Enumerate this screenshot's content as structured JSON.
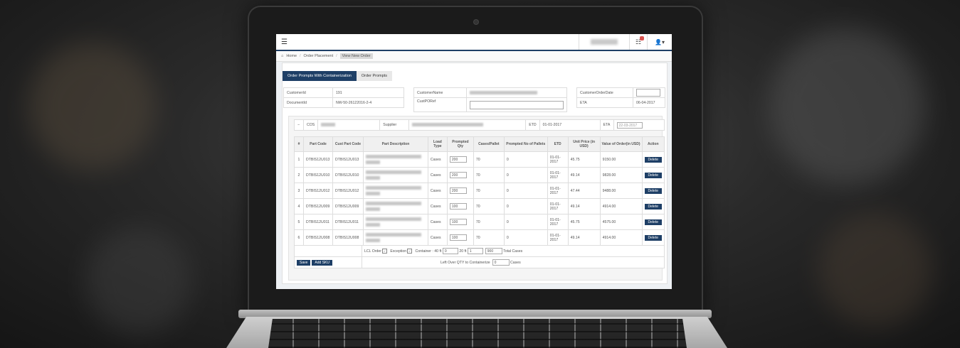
{
  "topbar": {
    "menu_icon": "hamburger-icon",
    "notification_icon": "list-icon",
    "user_icon": "user-icon",
    "user_caret": "▾"
  },
  "breadcrumb": {
    "home": "Home",
    "order_placement": "Order Placement",
    "current": "View New Order"
  },
  "tabs": {
    "containerization": "Order Prompts With Containerization",
    "order_prompts": "Order Prompts"
  },
  "info": {
    "customer_id_label": "CustomerId",
    "customer_id_value": "191",
    "document_id_label": "DocumentId",
    "document_id_value": "NW-50-26122016-2-4",
    "customer_name_label": "CustomerName",
    "cust_po_ref_label": "CustPORef",
    "customer_order_date_label": "CustomerOrderDate",
    "eta_label": "ETA",
    "eta_value": "06-04-2017"
  },
  "cos_row": {
    "toggle": "−",
    "cos_label": "COS",
    "supplier_label": "Supplier",
    "etd_label": "ETD",
    "etd_value": "01-01-2017",
    "eta_label": "ETA",
    "eta_value": "22-03-2017"
  },
  "grid": {
    "headers": [
      "#",
      "Part Code",
      "Cust Part Code",
      "Part Description",
      "Load Type",
      "Prompted Qty",
      "Cases/Pallet",
      "Prompted No of Pallets",
      "ETD",
      "Unit Price (in USD)",
      "Value of Order(in USD)",
      "Action"
    ],
    "rows": [
      {
        "n": "1",
        "part": "DTBIS12U013",
        "cust": "DTBIS12U013",
        "load": "Cases",
        "qty": "200",
        "cpp": "70",
        "pallets": "0",
        "etd": "01-01-2017",
        "price": "45.75",
        "value": "9150.00",
        "action": "Delete"
      },
      {
        "n": "2",
        "part": "DTBIS12U010",
        "cust": "DTBIS12U010",
        "load": "Cases",
        "qty": "200",
        "cpp": "70",
        "pallets": "0",
        "etd": "01-01-2017",
        "price": "49.14",
        "value": "9828.00",
        "action": "Delete"
      },
      {
        "n": "3",
        "part": "DTBIS12U012",
        "cust": "DTBIS12U012",
        "load": "Cases",
        "qty": "200",
        "cpp": "70",
        "pallets": "0",
        "etd": "01-01-2017",
        "price": "47.44",
        "value": "9488.00",
        "action": "Delete"
      },
      {
        "n": "4",
        "part": "DTBIS12U009",
        "cust": "DTBIS12U009",
        "load": "Cases",
        "qty": "100",
        "cpp": "70",
        "pallets": "0",
        "etd": "01-01-2017",
        "price": "49.14",
        "value": "4914.00",
        "action": "Delete"
      },
      {
        "n": "5",
        "part": "DTBIS12U011",
        "cust": "DTBIS12U011",
        "load": "Cases",
        "qty": "100",
        "cpp": "70",
        "pallets": "0",
        "etd": "01-01-2017",
        "price": "45.75",
        "value": "4575.00",
        "action": "Delete"
      },
      {
        "n": "6",
        "part": "DTBIS12U008",
        "cust": "DTBIS12U008",
        "load": "Cases",
        "qty": "100",
        "cpp": "70",
        "pallets": "0",
        "etd": "01-01-2017",
        "price": "49.14",
        "value": "4914.00",
        "action": "Delete"
      }
    ]
  },
  "footer": {
    "lcl_label": "LCL Order",
    "exception_label": "Exception",
    "container_label": "Container : 40 ft",
    "container_40_value": "0",
    "ft20_label": "20 ft",
    "container_20_value": "1",
    "total_value": "900",
    "total_label": "Total Cases",
    "save_label": "Save",
    "add_sku_label": "Add SKU",
    "leftover_label": "Left Over QTY to Containerize",
    "leftover_value": "0",
    "leftover_unit": "Cases"
  },
  "colors": {
    "primary": "#1e3f66",
    "badge": "#d9534f"
  }
}
